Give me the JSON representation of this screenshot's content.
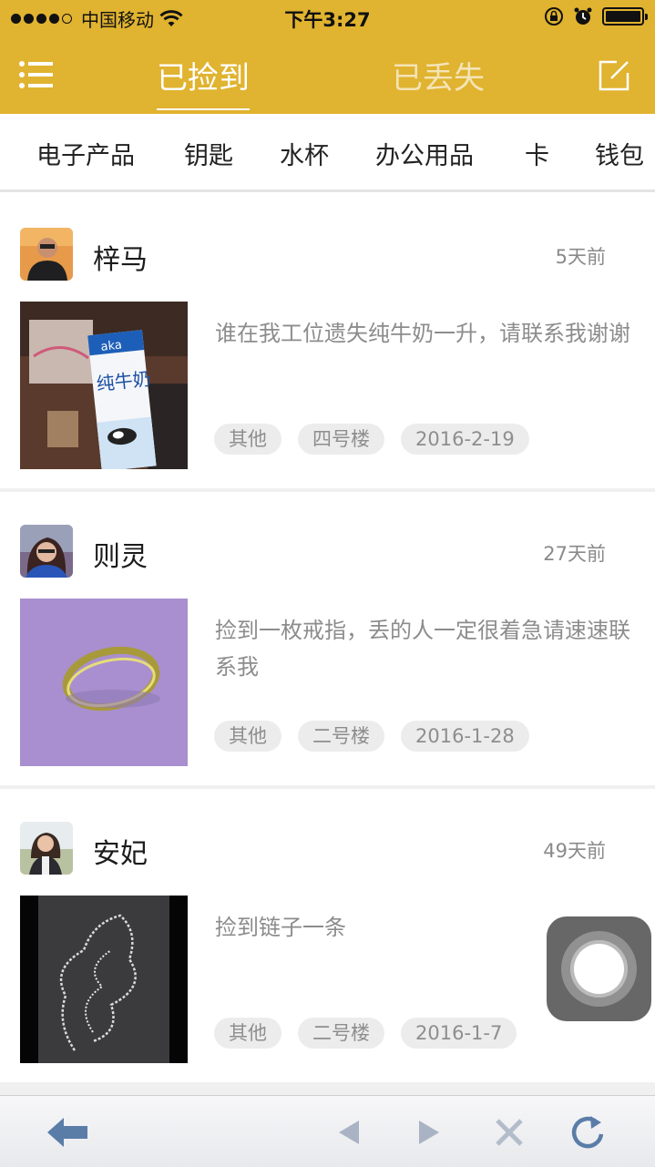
{
  "status_bar": {
    "carrier": "中国移动",
    "time": "下午3:27"
  },
  "nav": {
    "tabs": [
      "已捡到",
      "已丢失"
    ],
    "active_tab": "已捡到"
  },
  "categories": [
    "电子产品",
    "钥匙",
    "水杯",
    "办公用品",
    "卡",
    "钱包"
  ],
  "posts": [
    {
      "user": "梓马",
      "time_ago": "5天前",
      "text": "谁在我工位遗失纯牛奶一升，请联系我谢谢",
      "tags": [
        "其他",
        "四号楼",
        "2016-2-19"
      ]
    },
    {
      "user": "则灵",
      "time_ago": "27天前",
      "text": "捡到一枚戒指，丢的人一定很着急请速速联系我",
      "tags": [
        "其他",
        "二号楼",
        "2016-1-28"
      ]
    },
    {
      "user": "安妃",
      "time_ago": "49天前",
      "text": "捡到链子一条",
      "tags": [
        "其他",
        "二号楼",
        "2016-1-7"
      ]
    }
  ],
  "colors": {
    "brand_yellow": "#E0B330",
    "toolbar_icon_blue": "#5a7da8"
  },
  "icons": {
    "menu": "list-menu-icon",
    "edit": "compose-icon",
    "toolbar": [
      "back-arrow-icon",
      "prev-icon",
      "next-icon",
      "close-icon",
      "refresh-icon"
    ]
  }
}
